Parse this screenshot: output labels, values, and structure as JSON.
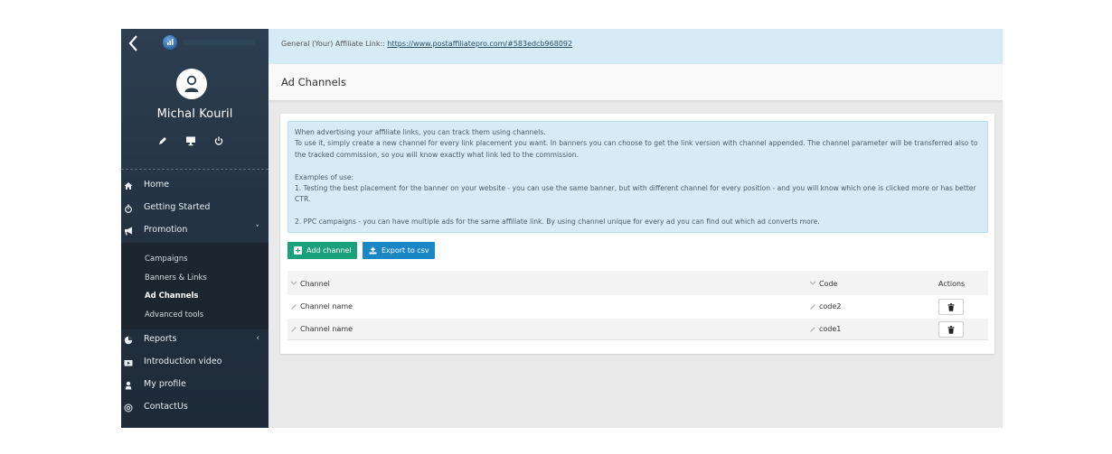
{
  "sidebar": {
    "back_icon": "chevron-left-icon",
    "logo_icon": "post-affiliate-pro-logo",
    "user": {
      "name": "Michal Kouril",
      "avatar_icon": "user-icon",
      "actions": [
        {
          "name": "edit-profile",
          "icon": "pencil-icon"
        },
        {
          "name": "monitor",
          "icon": "monitor-icon"
        },
        {
          "name": "logout",
          "icon": "power-icon"
        }
      ]
    },
    "nav": [
      {
        "label": "Home",
        "icon": "home-icon"
      },
      {
        "label": "Getting Started",
        "icon": "stopwatch-icon"
      },
      {
        "label": "Promotion",
        "icon": "bullhorn-icon",
        "chevron": "˅",
        "expanded": true,
        "children": [
          {
            "label": "Campaigns"
          },
          {
            "label": "Banners & Links"
          },
          {
            "label": "Ad Channels",
            "active": true
          },
          {
            "label": "Advanced tools"
          }
        ]
      },
      {
        "label": "Reports",
        "icon": "pie-chart-icon",
        "chevron": "‹"
      },
      {
        "label": "Introduction video",
        "icon": "video-icon"
      },
      {
        "label": "My profile",
        "icon": "user-icon"
      },
      {
        "label": "ContactUs",
        "icon": "at-icon"
      }
    ]
  },
  "affiliate_bar": {
    "label": "General (Your) Affiliate Link:: ",
    "link": "https://www.postaffiliatepro.com/#583edcb968092"
  },
  "page": {
    "title": "Ad Channels"
  },
  "info": {
    "lines": [
      "When advertising your affiliate links, you can track them using channels.",
      "To use it, simply create a new channel for every link placement you want. In banners you can choose to get the link version with channel appended. The channel parameter will be transferred also to",
      "the tracked commission, so you will know exactly what link led to the commission.",
      "",
      "Examples of use:",
      "1. Testing the best placement for the banner on your website - you can use the same banner, but with different channel for every position - and you will know which one is clicked more or has better",
      "CTR.",
      "",
      "2. PPC campaigns - you can have multiple ads for the same affiliate link. By using channel unique for every ad you can find out which ad converts more."
    ]
  },
  "toolbar": {
    "add_label": "Add channel",
    "export_label": "Export to csv",
    "add_color": "#1aa07a",
    "export_color": "#1b86c6"
  },
  "table": {
    "columns": {
      "channel": "Channel",
      "code": "Code",
      "actions": "Actions"
    },
    "rows": [
      {
        "channel": "Channel name",
        "code": "code2"
      },
      {
        "channel": "Channel name",
        "code": "code1"
      }
    ]
  }
}
